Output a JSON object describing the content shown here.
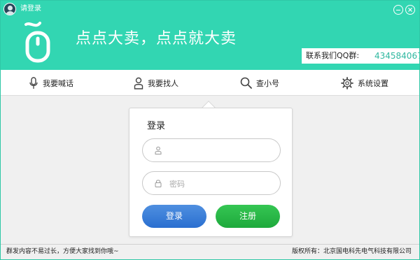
{
  "window": {
    "title": "请登录",
    "accent_color": "#32d6b2",
    "minimize_icon": "minimize-icon",
    "close_icon": "close-icon"
  },
  "header": {
    "logo_icon": "mouse-logo-icon",
    "slogan": "点点大卖，点点就大卖",
    "qq_label": "联系我们QQ群:",
    "qq_number": "434584067"
  },
  "nav": {
    "items": [
      {
        "label": "我要喊话",
        "icon": "microphone-icon"
      },
      {
        "label": "我要找人",
        "icon": "person-icon"
      },
      {
        "label": "查小号",
        "icon": "search-icon"
      },
      {
        "label": "系统设置",
        "icon": "gear-icon"
      }
    ]
  },
  "login": {
    "title": "登录",
    "username_value": "",
    "username_placeholder": "",
    "password_value": "",
    "password_placeholder": "密码",
    "login_button": "登录",
    "register_button": "注册",
    "login_color": "#2a6fd0",
    "register_color": "#1ea93c"
  },
  "status": {
    "left_text": "群发内容不易过长，方便大家找到你哦~",
    "right_text": "版权所有：北京国电科先电气科技有限公司"
  }
}
